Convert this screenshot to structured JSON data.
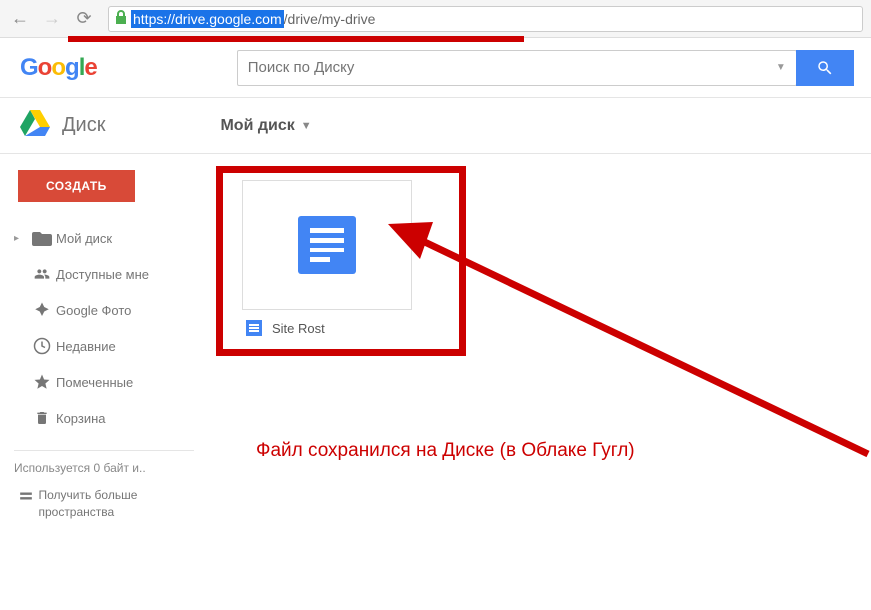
{
  "browser": {
    "url_highlighted": "https://drive.google.com",
    "url_rest": "/drive/my-drive"
  },
  "logo": {
    "text": "Google"
  },
  "search": {
    "placeholder": "Поиск по Диску"
  },
  "product": {
    "name": "Диск"
  },
  "breadcrumb": {
    "label": "Мой диск"
  },
  "create_button": "СОЗДАТЬ",
  "sidebar": {
    "items": [
      {
        "label": "Мой диск",
        "icon": "folder"
      },
      {
        "label": "Доступные мне",
        "icon": "shared"
      },
      {
        "label": "Google Фото",
        "icon": "photos"
      },
      {
        "label": "Недавние",
        "icon": "clock"
      },
      {
        "label": "Помеченные",
        "icon": "star"
      },
      {
        "label": "Корзина",
        "icon": "trash"
      }
    ],
    "storage_used": "Используется 0 байт и..",
    "storage_link": "Получить больше пространства"
  },
  "files": [
    {
      "name": "Site Rost",
      "type": "doc"
    }
  ],
  "annotation": {
    "text": "Файл сохранился на Диске (в Облаке Гугл)"
  }
}
